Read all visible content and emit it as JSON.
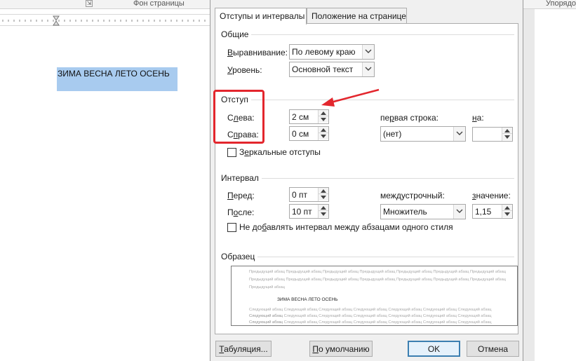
{
  "ribbon": {
    "page_background_label": "Фон страницы",
    "arrange_label": "Упорядо"
  },
  "document": {
    "selected_text": "ЗИМА ВЕСНА ЛЕТО ОСЕНЬ"
  },
  "dialog": {
    "tabs": [
      {
        "label": "Отступы и интервалы",
        "active": true
      },
      {
        "label": "Положение на странице",
        "active": false
      }
    ],
    "general": {
      "title": "Общие",
      "alignment_label": "Выравнивание:",
      "alignment_value": "По левому краю",
      "level_label": "Уровень:",
      "level_value": "Основной текст"
    },
    "indent": {
      "title": "Отступ",
      "left_label": "Слева:",
      "left_value": "2 см",
      "right_label": "Справа:",
      "right_value": "0 см",
      "first_line_label": "первая строка:",
      "first_line_value": "(нет)",
      "by_label": "на:",
      "by_value": "",
      "mirror_label": "Зеркальные отступы",
      "mirror_checked": false
    },
    "spacing": {
      "title": "Интервал",
      "before_label": "Перед:",
      "before_value": "0 пт",
      "after_label": "После:",
      "after_value": "10 пт",
      "line_spacing_label": "междустрочный:",
      "line_spacing_value": "Множитель",
      "at_label": "значение:",
      "at_value": "1,15",
      "dont_add_label": "Не добавлять интервал между абзацами одного стиля",
      "dont_add_checked": false
    },
    "preview": {
      "title": "Образец",
      "prev_lines": [
        "Предыдущий абзац Предыдущий абзац Предыдущий абзац Предыдущий абзац Предыдущий абзац Предыдущий абзац Предыдущий абзац",
        "Предыдущий абзац Предыдущий абзац Предыдущий абзац Предыдущий абзац Предыдущий абзац Предыдущий абзац Предыдущий абзац",
        "Предыдущий абзац"
      ],
      "main_text": "ЗИМА ВЕСНА ЛЕТО ОСЕНЬ",
      "next_lines": [
        "Следующий абзац Следующий абзац Следующий абзац Следующий абзац Следующий абзац Следующий абзац Следующий абзац Следующий абзац",
        "Следующий абзац Следующий абзац Следующий абзац Следующий абзац Следующий абзац Следующий абзац Следующий абзац Следующий абзац",
        "Следующий абзац Следующий абзац Следующий абзац Следующий абзац Следующий абзац Следующий абзац Следующий абзац Следующий абзац"
      ]
    },
    "buttons": {
      "tabs_label": "Табуляция...",
      "default_label": "По умолчанию",
      "ok_label": "OK",
      "cancel_label": "Отмена"
    }
  },
  "colors": {
    "annotation_red": "#e3262d",
    "selection_blue": "#a8cbef",
    "ok_border": "#3c7fb1"
  }
}
